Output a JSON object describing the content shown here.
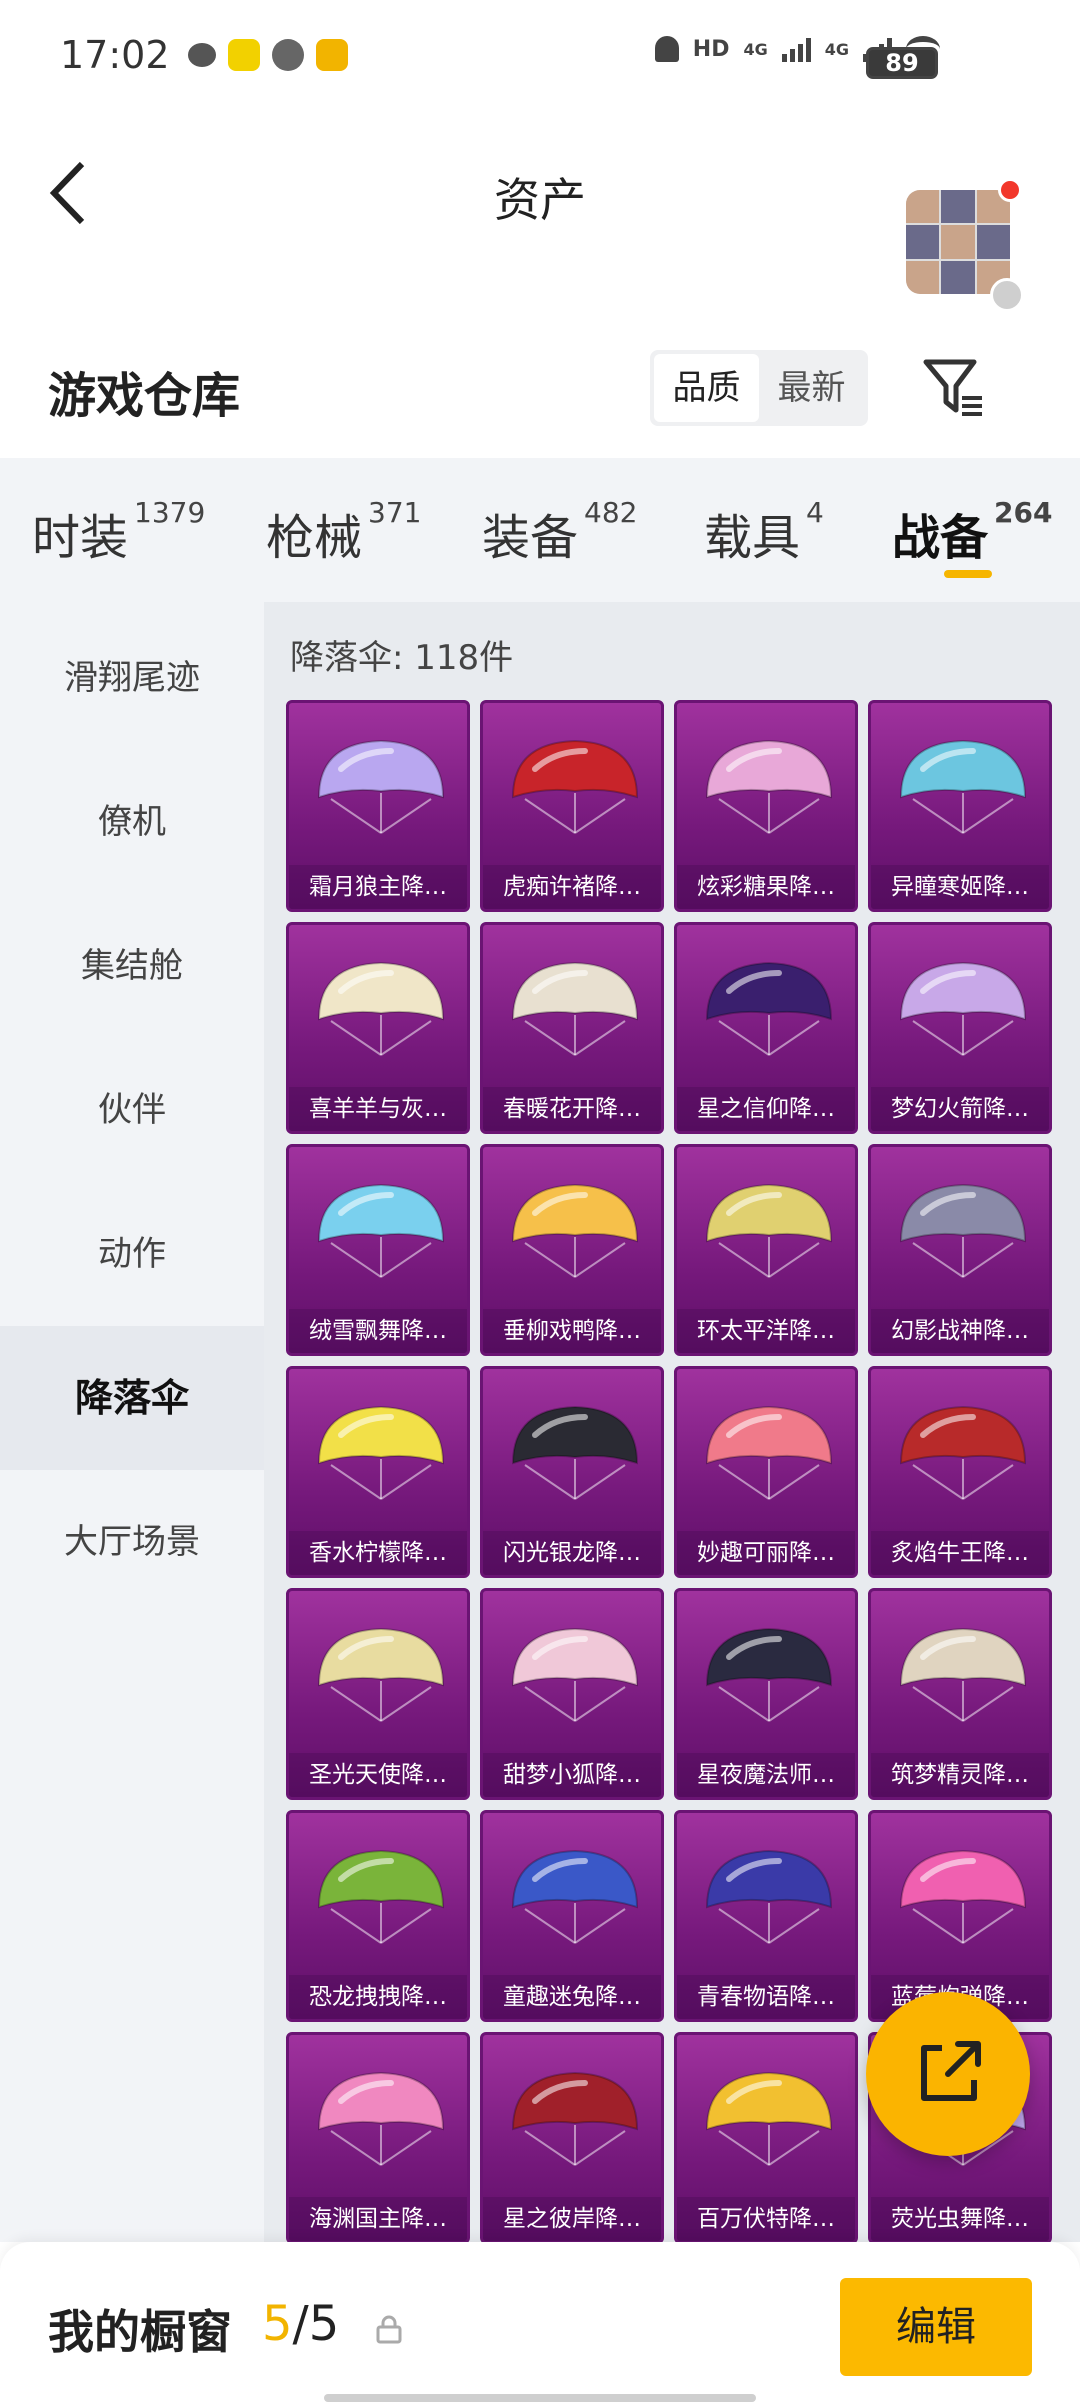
{
  "status": {
    "time": "17:02",
    "network": [
      "HD",
      "4G",
      "4G"
    ],
    "battery": "89"
  },
  "header": {
    "title": "资产"
  },
  "warehouse": {
    "title": "游戏仓库",
    "sort_options": [
      "品质",
      "最新"
    ],
    "active_sort": "品质"
  },
  "tabs": [
    {
      "label": "时装",
      "count": "1379"
    },
    {
      "label": "枪械",
      "count": "371"
    },
    {
      "label": "装备",
      "count": "482"
    },
    {
      "label": "载具",
      "count": "4"
    },
    {
      "label": "战备",
      "count": "264"
    }
  ],
  "active_tab": "战备",
  "side_nav": [
    "滑翔尾迹",
    "僚机",
    "集结舱",
    "伙伴",
    "动作",
    "降落伞",
    "大厅场景"
  ],
  "active_side": "降落伞",
  "content": {
    "count_label": "降落伞: 118件",
    "items": [
      "霜月狼主降…",
      "虎痴许褚降…",
      "炫彩糖果降…",
      "异瞳寒姬降…",
      "喜羊羊与灰…",
      "春暖花开降…",
      "星之信仰降…",
      "梦幻火箭降…",
      "绒雪飘舞降…",
      "垂柳戏鸭降…",
      "环太平洋降…",
      "幻影战神降…",
      "香水柠檬降…",
      "闪光银龙降…",
      "妙趣可丽降…",
      "炙焰牛王降…",
      "圣光天使降…",
      "甜梦小狐降…",
      "星夜魔法师…",
      "筑梦精灵降…",
      "恐龙拽拽降…",
      "童趣迷兔降…",
      "青春物语降…",
      "蓝莓炮弹降…",
      "海渊国主降…",
      "星之彼岸降…",
      "百万伏特降…",
      "荧光虫舞降…"
    ],
    "item_colors": [
      "#b9a7f0",
      "#c8242a",
      "#e8a8d8",
      "#6cc6e0",
      "#f0e6c8",
      "#e8e0d0",
      "#3a1f6e",
      "#c8a8e8",
      "#7ad0ee",
      "#f6c04a",
      "#e0d070",
      "#8a8aa8",
      "#f2e048",
      "#2a2a33",
      "#f07a8a",
      "#b82a2a",
      "#e8dca0",
      "#f0c8d8",
      "#2a2a40",
      "#e0d4c0",
      "#7ab43a",
      "#3a58c8",
      "#3a3aa8",
      "#f060b0",
      "#f088c0",
      "#a0202a",
      "#f2c030",
      "#c0a8f0"
    ]
  },
  "bottom_bar": {
    "label": "我的橱窗",
    "current": "5",
    "sep_total": "/5",
    "edit_label": "编辑"
  }
}
